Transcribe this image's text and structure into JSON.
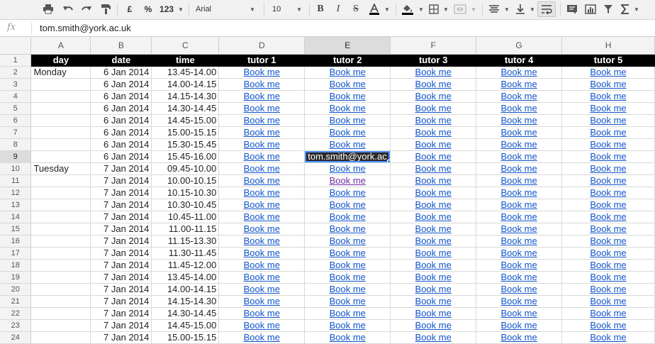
{
  "toolbar": {
    "currency_label": "£",
    "percent_label": "%",
    "format_label": "123",
    "font_family": "Arial",
    "font_size": "10"
  },
  "formula_bar": {
    "fx_label": "fx",
    "value": "tom.smith@york.ac.uk"
  },
  "columns": [
    "A",
    "B",
    "C",
    "D",
    "E",
    "F",
    "G",
    "H"
  ],
  "header": [
    "day",
    "date",
    "time",
    "tutor 1",
    "tutor 2",
    "tutor 3",
    "tutor 4",
    "tutor 5"
  ],
  "link_label": "Book me",
  "rows": [
    {
      "num": "2",
      "day": "Monday",
      "date": "6 Jan 2014",
      "time": "13.45-14.00"
    },
    {
      "num": "3",
      "day": "",
      "date": "6 Jan 2014",
      "time": "14.00-14.15"
    },
    {
      "num": "4",
      "day": "",
      "date": "6 Jan 2014",
      "time": "14.15-14.30"
    },
    {
      "num": "5",
      "day": "",
      "date": "6 Jan 2014",
      "time": "14.30-14.45"
    },
    {
      "num": "6",
      "day": "",
      "date": "6 Jan 2014",
      "time": "14.45-15.00"
    },
    {
      "num": "7",
      "day": "",
      "date": "6 Jan 2014",
      "time": "15.00-15.15"
    },
    {
      "num": "8",
      "day": "",
      "date": "6 Jan 2014",
      "time": "15.30-15.45"
    },
    {
      "num": "9",
      "day": "",
      "date": "6 Jan 2014",
      "time": "15.45-16.00",
      "selected_text": "tom.smith@york.ac"
    },
    {
      "num": "10",
      "day": "Tuesday",
      "date": "7 Jan 2014",
      "time": "09.45-10.00"
    },
    {
      "num": "11",
      "day": "",
      "date": "7 Jan 2014",
      "time": "10.00-10.15",
      "visited_tutor2": true
    },
    {
      "num": "12",
      "day": "",
      "date": "7 Jan 2014",
      "time": "10.15-10.30"
    },
    {
      "num": "13",
      "day": "",
      "date": "7 Jan 2014",
      "time": "10.30-10.45"
    },
    {
      "num": "14",
      "day": "",
      "date": "7 Jan 2014",
      "time": "10.45-11.00"
    },
    {
      "num": "15",
      "day": "",
      "date": "7 Jan 2014",
      "time": "11.00-11.15"
    },
    {
      "num": "16",
      "day": "",
      "date": "7 Jan 2014",
      "time": "11.15-13.30"
    },
    {
      "num": "17",
      "day": "",
      "date": "7 Jan 2014",
      "time": "11.30-11.45"
    },
    {
      "num": "18",
      "day": "",
      "date": "7 Jan 2014",
      "time": "11.45-12.00"
    },
    {
      "num": "19",
      "day": "",
      "date": "7 Jan 2014",
      "time": "13.45-14.00"
    },
    {
      "num": "20",
      "day": "",
      "date": "7 Jan 2014",
      "time": "14.00-14.15"
    },
    {
      "num": "21",
      "day": "",
      "date": "7 Jan 2014",
      "time": "14.15-14.30"
    },
    {
      "num": "22",
      "day": "",
      "date": "7 Jan 2014",
      "time": "14.30-14.45"
    },
    {
      "num": "23",
      "day": "",
      "date": "7 Jan 2014",
      "time": "14.45-15.00"
    },
    {
      "num": "24",
      "day": "",
      "date": "7 Jan 2014",
      "time": "15.00-15.15"
    }
  ],
  "header_row_num": "1",
  "active_column": "E",
  "active_row": "9",
  "colors": {
    "link": "#1155cc",
    "visited": "#6f2ea3",
    "selection": "#4d90fe",
    "header_bg": "#000000"
  }
}
